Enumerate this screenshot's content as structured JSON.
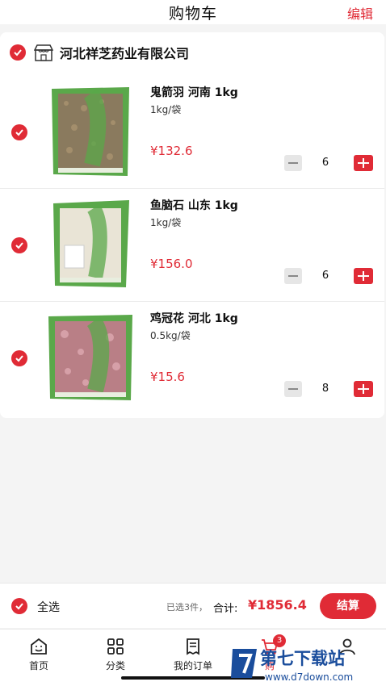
{
  "header": {
    "title": "购物车",
    "edit_label": "编辑"
  },
  "store": {
    "name": "河北祥芝药业有限公司"
  },
  "items": [
    {
      "name": "鬼箭羽 河南 1kg",
      "spec": "1kg/袋",
      "price": "¥132.6",
      "qty": "6"
    },
    {
      "name": "鱼脑石 山东 1kg",
      "spec": "1kg/袋",
      "price": "¥156.0",
      "qty": "6"
    },
    {
      "name": "鸡冠花 河北 1kg",
      "spec": "0.5kg/袋",
      "price": "¥15.6",
      "qty": "8"
    }
  ],
  "footer": {
    "select_all": "全选",
    "selected_count": "已选3件，",
    "total_label": "合计:",
    "total": "¥1856.4",
    "checkout": "结算"
  },
  "tabs": [
    {
      "label": "首页",
      "icon": "home-icon"
    },
    {
      "label": "分类",
      "icon": "category-icon"
    },
    {
      "label": "我的订单",
      "icon": "orders-icon"
    },
    {
      "label": "购",
      "icon": "cart-icon",
      "badge": "3",
      "active": true
    },
    {
      "label": "",
      "icon": "profile-icon"
    }
  ],
  "watermark": {
    "text": "第七下载站",
    "url": "www.d7down.com"
  },
  "colors": {
    "accent": "#e02b36",
    "package_green": "#5aa84a"
  }
}
